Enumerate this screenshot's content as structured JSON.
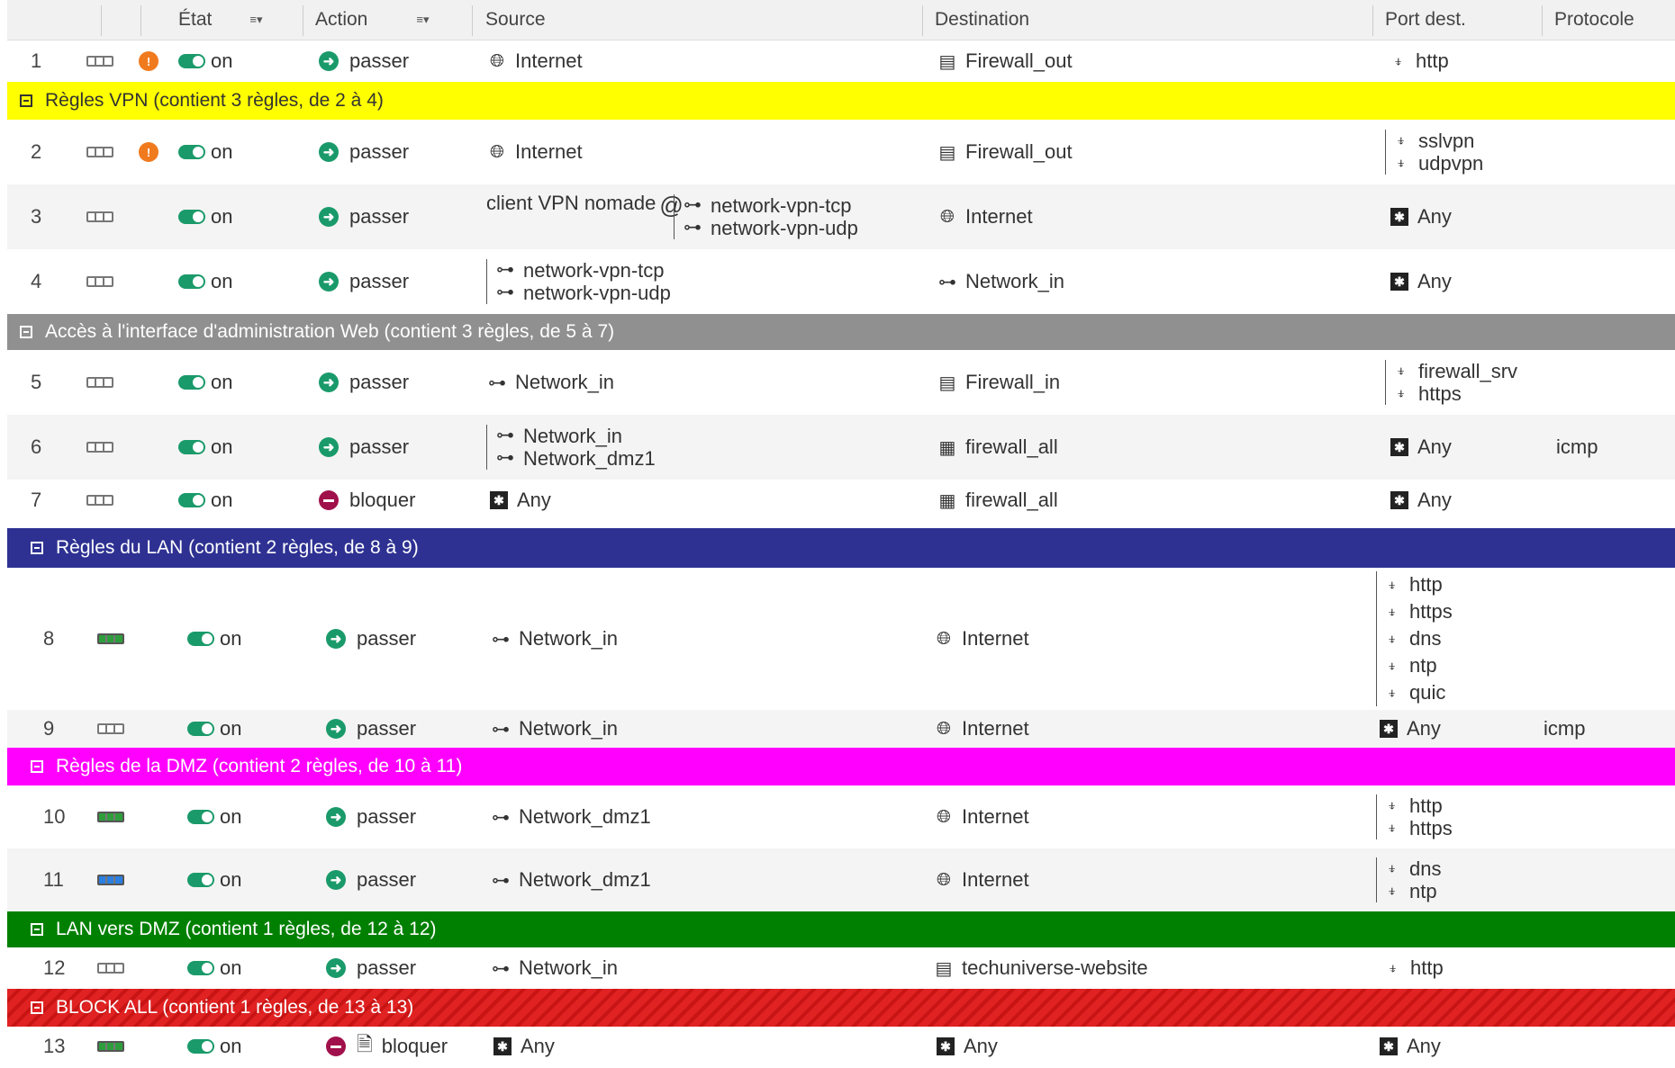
{
  "columns": {
    "etat": "État",
    "action": "Action",
    "source": "Source",
    "destination": "Destination",
    "port": "Port dest.",
    "protocole": "Protocole"
  },
  "row1": {
    "num": "1",
    "state": "on",
    "action": "passer",
    "source": "Internet",
    "dest": "Firewall_out",
    "port": "http"
  },
  "sections": {
    "vpn": "Règles VPN (contient 3 règles, de 2 à 4)",
    "admin": "Accès à l'interface d'administration Web (contient 3 règles, de 5 à 7)",
    "lan": "Règles du LAN (contient 2 règles, de 8 à 9)",
    "dmz": "Règles de la DMZ (contient 2 règles, de 10 à 11)",
    "landmz": "LAN vers DMZ (contient 1 règles, de 12 à 12)",
    "block": "BLOCK ALL (contient 1 règles, de 13 à 13)"
  },
  "rules": {
    "r2": {
      "num": "2",
      "state": "on",
      "action": "passer",
      "source": "Internet",
      "dest": "Firewall_out",
      "ports": [
        "sslvpn",
        "udpvpn"
      ]
    },
    "r3": {
      "num": "3",
      "state": "on",
      "action": "passer",
      "source_user": "client VPN nomade",
      "at": "@",
      "sources": [
        "network-vpn-tcp",
        "network-vpn-udp"
      ],
      "dest": "Internet",
      "port": "Any"
    },
    "r4": {
      "num": "4",
      "state": "on",
      "action": "passer",
      "sources": [
        "network-vpn-tcp",
        "network-vpn-udp"
      ],
      "dest": "Network_in",
      "port": "Any"
    },
    "r5": {
      "num": "5",
      "state": "on",
      "action": "passer",
      "source": "Network_in",
      "dest": "Firewall_in",
      "ports": [
        "firewall_srv",
        "https"
      ]
    },
    "r6": {
      "num": "6",
      "state": "on",
      "action": "passer",
      "sources": [
        "Network_in",
        "Network_dmz1"
      ],
      "dest": "firewall_all",
      "port": "Any",
      "proto": "icmp"
    },
    "r7": {
      "num": "7",
      "state": "on",
      "action": "bloquer",
      "source": "Any",
      "dest": "firewall_all",
      "port": "Any"
    },
    "r8": {
      "num": "8",
      "state": "on",
      "action": "passer",
      "source": "Network_in",
      "dest": "Internet",
      "ports": [
        "http",
        "https",
        "dns",
        "ntp",
        "quic"
      ]
    },
    "r9": {
      "num": "9",
      "state": "on",
      "action": "passer",
      "source": "Network_in",
      "dest": "Internet",
      "port": "Any",
      "proto": "icmp"
    },
    "r10": {
      "num": "10",
      "state": "on",
      "action": "passer",
      "source": "Network_dmz1",
      "dest": "Internet",
      "ports": [
        "http",
        "https"
      ]
    },
    "r11": {
      "num": "11",
      "state": "on",
      "action": "passer",
      "source": "Network_dmz1",
      "dest": "Internet",
      "ports": [
        "dns",
        "ntp"
      ]
    },
    "r12": {
      "num": "12",
      "state": "on",
      "action": "passer",
      "source": "Network_in",
      "dest": "techuniverse-website",
      "port": "http"
    },
    "r13": {
      "num": "13",
      "state": "on",
      "action": "bloquer",
      "source": "Any",
      "dest": "Any",
      "port": "Any"
    }
  },
  "icons": {
    "state": "rule-state-icon",
    "warning": "warning-icon",
    "toggle": "toggle-on-icon",
    "pass": "pass-arrow-icon",
    "block": "block-icon",
    "globe": "globe-icon",
    "firewall": "firewall-icon",
    "network": "network-icon",
    "any": "any-icon",
    "plug": "port-plug-icon",
    "group": "group-icon",
    "log": "log-document-icon"
  },
  "colors": {
    "vpn": "#ffff00",
    "admin": "#909090",
    "lan": "#2e3192",
    "dmz": "#ff00ff",
    "landmz": "#008000",
    "block": "#e02222"
  }
}
